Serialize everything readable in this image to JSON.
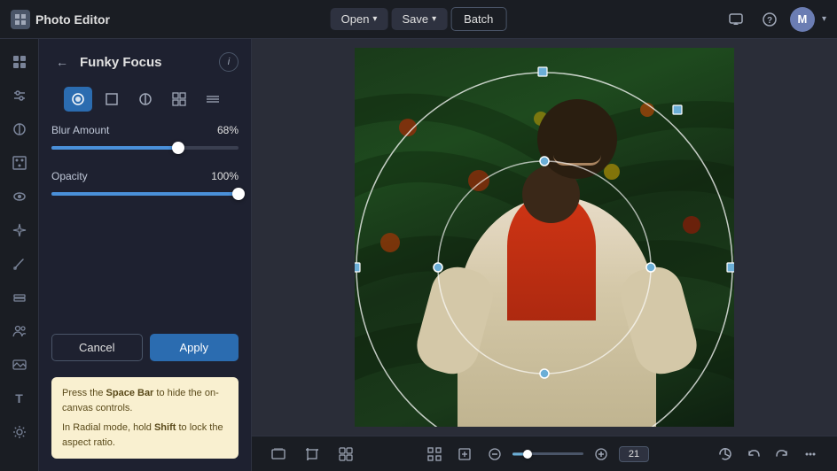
{
  "app": {
    "title": "Photo Editor",
    "logo_icon": "◼"
  },
  "topbar": {
    "open_label": "Open",
    "save_label": "Save",
    "batch_label": "Batch",
    "chevron": "▾",
    "avatar_initial": "M"
  },
  "iconbar": {
    "items": [
      {
        "id": "home",
        "icon": "⌂",
        "active": false
      },
      {
        "id": "adjust",
        "icon": "⚙",
        "active": false
      },
      {
        "id": "halfcircle",
        "icon": "◑",
        "active": false
      },
      {
        "id": "grid",
        "icon": "⊞",
        "active": false
      },
      {
        "id": "eye",
        "icon": "👁",
        "active": false
      },
      {
        "id": "sparkle",
        "icon": "✦",
        "active": false
      },
      {
        "id": "brush",
        "icon": "✏",
        "active": false
      },
      {
        "id": "layers",
        "icon": "▤",
        "active": false
      },
      {
        "id": "people",
        "icon": "👥",
        "active": false
      },
      {
        "id": "image",
        "icon": "🖼",
        "active": false
      },
      {
        "id": "text",
        "icon": "T",
        "active": false
      },
      {
        "id": "settings",
        "icon": "⚙",
        "active": false
      }
    ]
  },
  "panel": {
    "back_icon": "←",
    "title": "Funky Focus",
    "info_icon": "i",
    "mode_tabs": [
      {
        "id": "circle-fill",
        "icon": "◉",
        "active": true
      },
      {
        "id": "rect",
        "icon": "▭",
        "active": false
      },
      {
        "id": "halfcircle",
        "icon": "◑",
        "active": false
      },
      {
        "id": "grid4",
        "icon": "⊞",
        "active": false
      },
      {
        "id": "motion",
        "icon": "≋",
        "active": false
      }
    ],
    "blur_amount_label": "Blur Amount",
    "blur_amount_value": "68%",
    "blur_percent": 68,
    "opacity_label": "Opacity",
    "opacity_value": "100%",
    "opacity_percent": 100,
    "cancel_label": "Cancel",
    "apply_label": "Apply",
    "hint": {
      "line1_pre": "Press the ",
      "line1_key": "Space Bar",
      "line1_post": " to hide the on-canvas controls.",
      "line2_pre": "In Radial mode, hold ",
      "line2_key": "Shift",
      "line2_post": " to lock the aspect ratio."
    }
  },
  "bottombar": {
    "layers_icon": "⧉",
    "crop_icon": "⊡",
    "grid_icon": "⊞",
    "zoom_out_icon": "−",
    "zoom_slider_value": 21,
    "zoom_in_icon": "+",
    "zoom_value": "21",
    "undo_icon": "↺",
    "undo2_icon": "↶",
    "redo_icon": "↷",
    "more_icon": "⋯"
  }
}
